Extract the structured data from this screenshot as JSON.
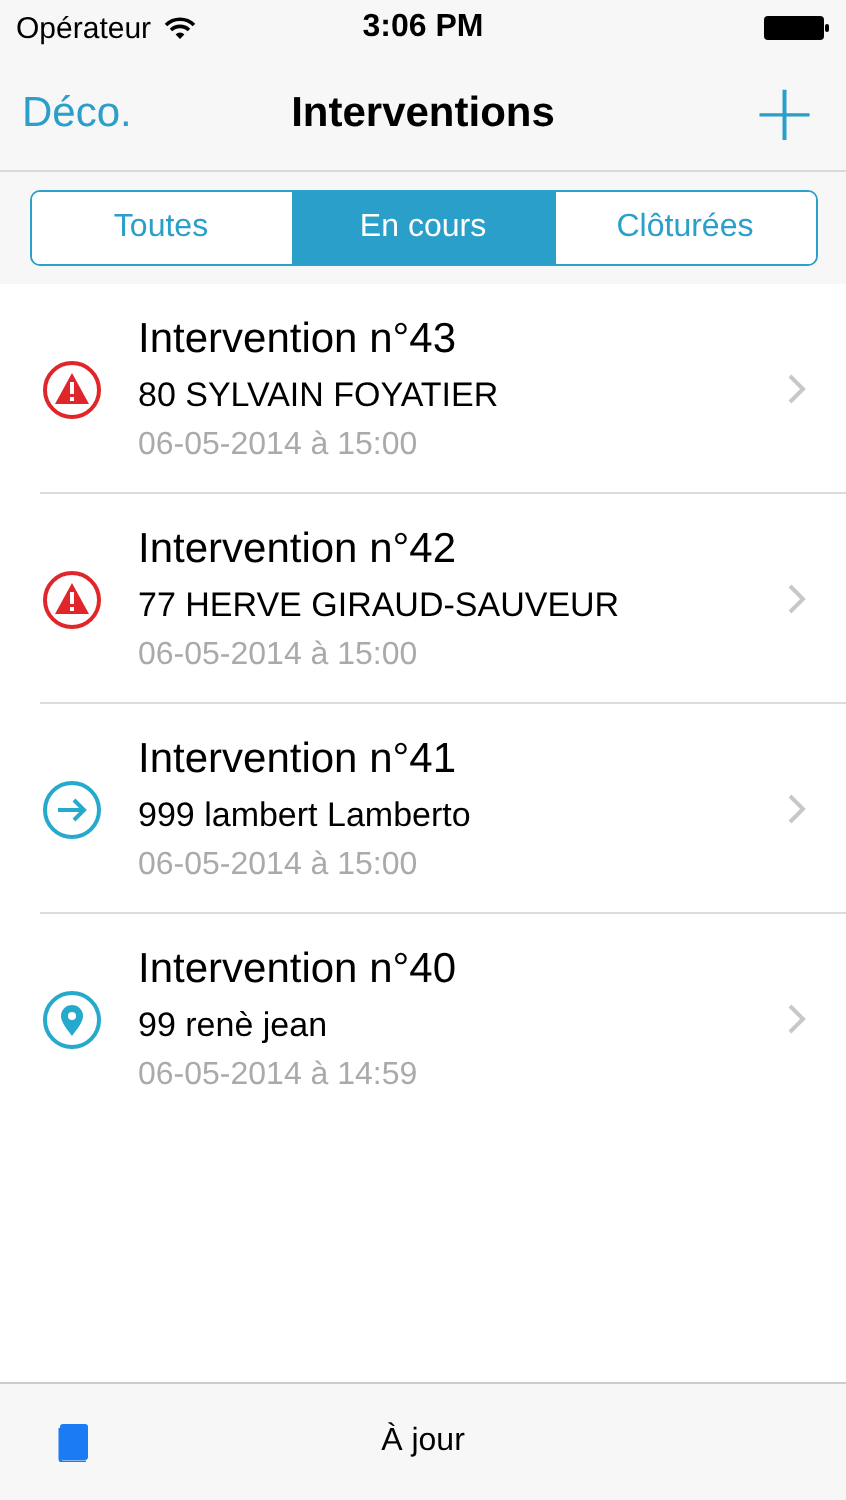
{
  "status_bar": {
    "carrier": "Opérateur",
    "time": "3:06 PM"
  },
  "nav": {
    "left": "Déco.",
    "title": "Interventions",
    "right": "+"
  },
  "tabs": [
    {
      "label": "Toutes",
      "selected": false
    },
    {
      "label": "En cours",
      "selected": true
    },
    {
      "label": "Clôturées",
      "selected": false
    }
  ],
  "rows": [
    {
      "kind": "alert",
      "title": "Intervention n°43",
      "client": "80 SYLVAIN FOYATIER",
      "date": "06-05-2014 à 15:00"
    },
    {
      "kind": "alert",
      "title": "Intervention n°42",
      "client": "77 HERVE GIRAUD-SAUVEUR",
      "date": "06-05-2014 à 15:00"
    },
    {
      "kind": "arrow",
      "title": "Intervention n°41",
      "client": "999 lambert Lamberto",
      "date": "06-05-2014 à 15:00"
    },
    {
      "kind": "pin",
      "title": "Intervention n°40",
      "client": "99 renè jean",
      "date": "06-05-2014 à 14:59"
    }
  ],
  "toolbar": {
    "status": "À jour"
  }
}
